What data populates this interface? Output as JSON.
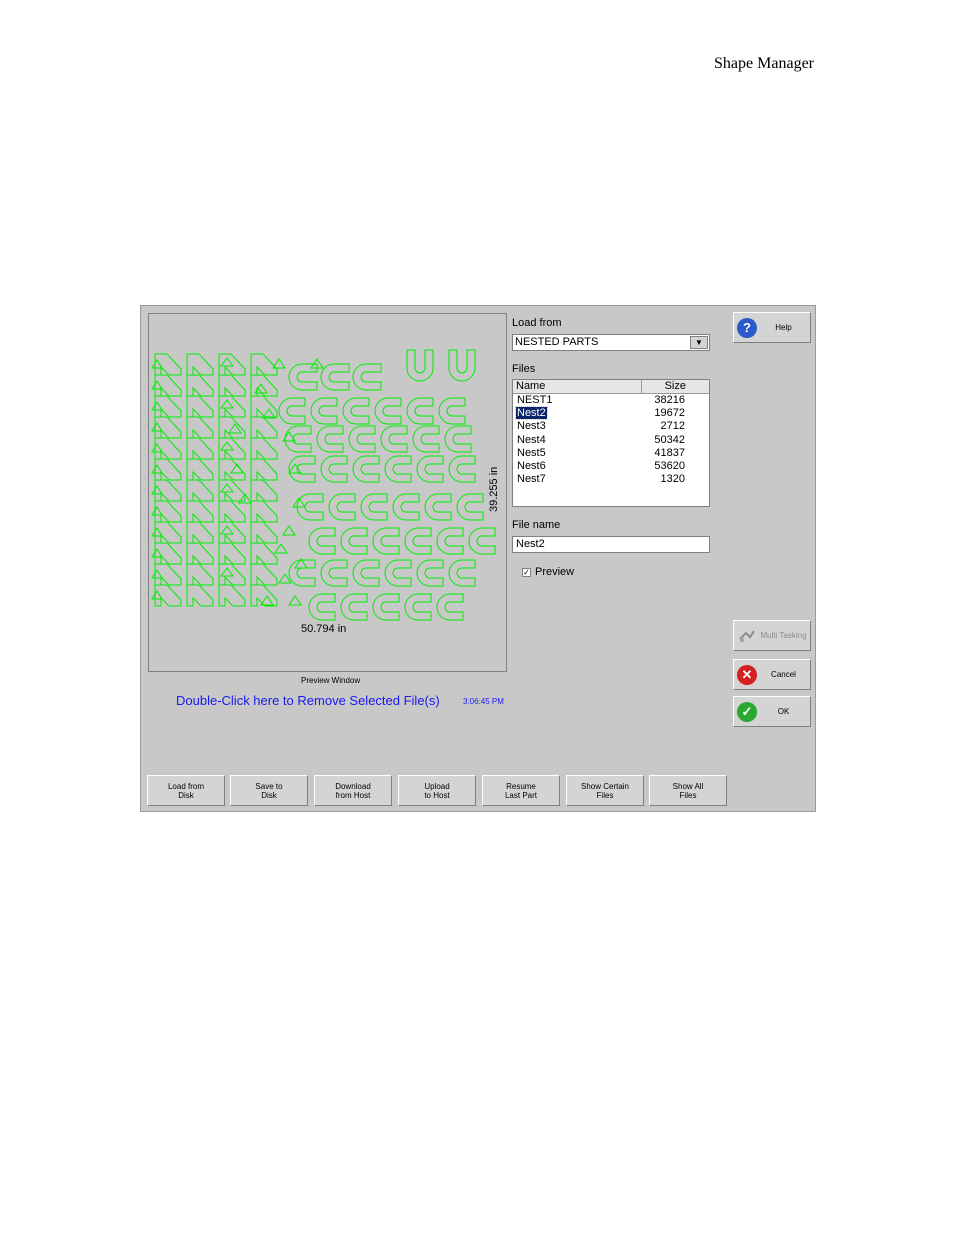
{
  "doc_header": "Shape Manager",
  "preview": {
    "width_label": "50.794 in",
    "height_label": "39.255 in",
    "caption": "Preview Window",
    "stroke_color": "#00ee00"
  },
  "remove_link": "Double-Click here to Remove Selected File(s)",
  "clock": "3:06:45 PM",
  "load_from": {
    "label": "Load from",
    "value": "NESTED PARTS",
    "arrow": "▼"
  },
  "files": {
    "label": "Files",
    "col_name": "Name",
    "col_size": "Size",
    "items": [
      {
        "name": "NEST1",
        "size": "38216"
      },
      {
        "name": "Nest2",
        "size": "19672"
      },
      {
        "name": "Nest3",
        "size": "2712"
      },
      {
        "name": "Nest4",
        "size": "50342"
      },
      {
        "name": "Nest5",
        "size": "41837"
      },
      {
        "name": "Nest6",
        "size": "53620"
      },
      {
        "name": "Nest7",
        "size": "1320"
      }
    ],
    "selected": "Nest2"
  },
  "file_name": {
    "label": "File name",
    "value": "Nest2"
  },
  "preview_checkbox": {
    "label": "Preview",
    "mark": "✓"
  },
  "side_buttons": {
    "help": "Help",
    "multitasking": "Multi Tasking",
    "cancel": "Cancel",
    "ok": "OK",
    "help_glyph": "?",
    "cancel_glyph": "✕",
    "ok_glyph": "✓"
  },
  "bottom_buttons": [
    {
      "line1": "Load from",
      "line2": "Disk"
    },
    {
      "line1": "Save to",
      "line2": "Disk"
    },
    {
      "line1": "Download",
      "line2": "from Host"
    },
    {
      "line1": "Upload",
      "line2": "to Host"
    },
    {
      "line1": "Resume",
      "line2": "Last Part"
    },
    {
      "line1": "Show Certain",
      "line2": "Files"
    },
    {
      "line1": "Show All",
      "line2": "Files"
    }
  ]
}
